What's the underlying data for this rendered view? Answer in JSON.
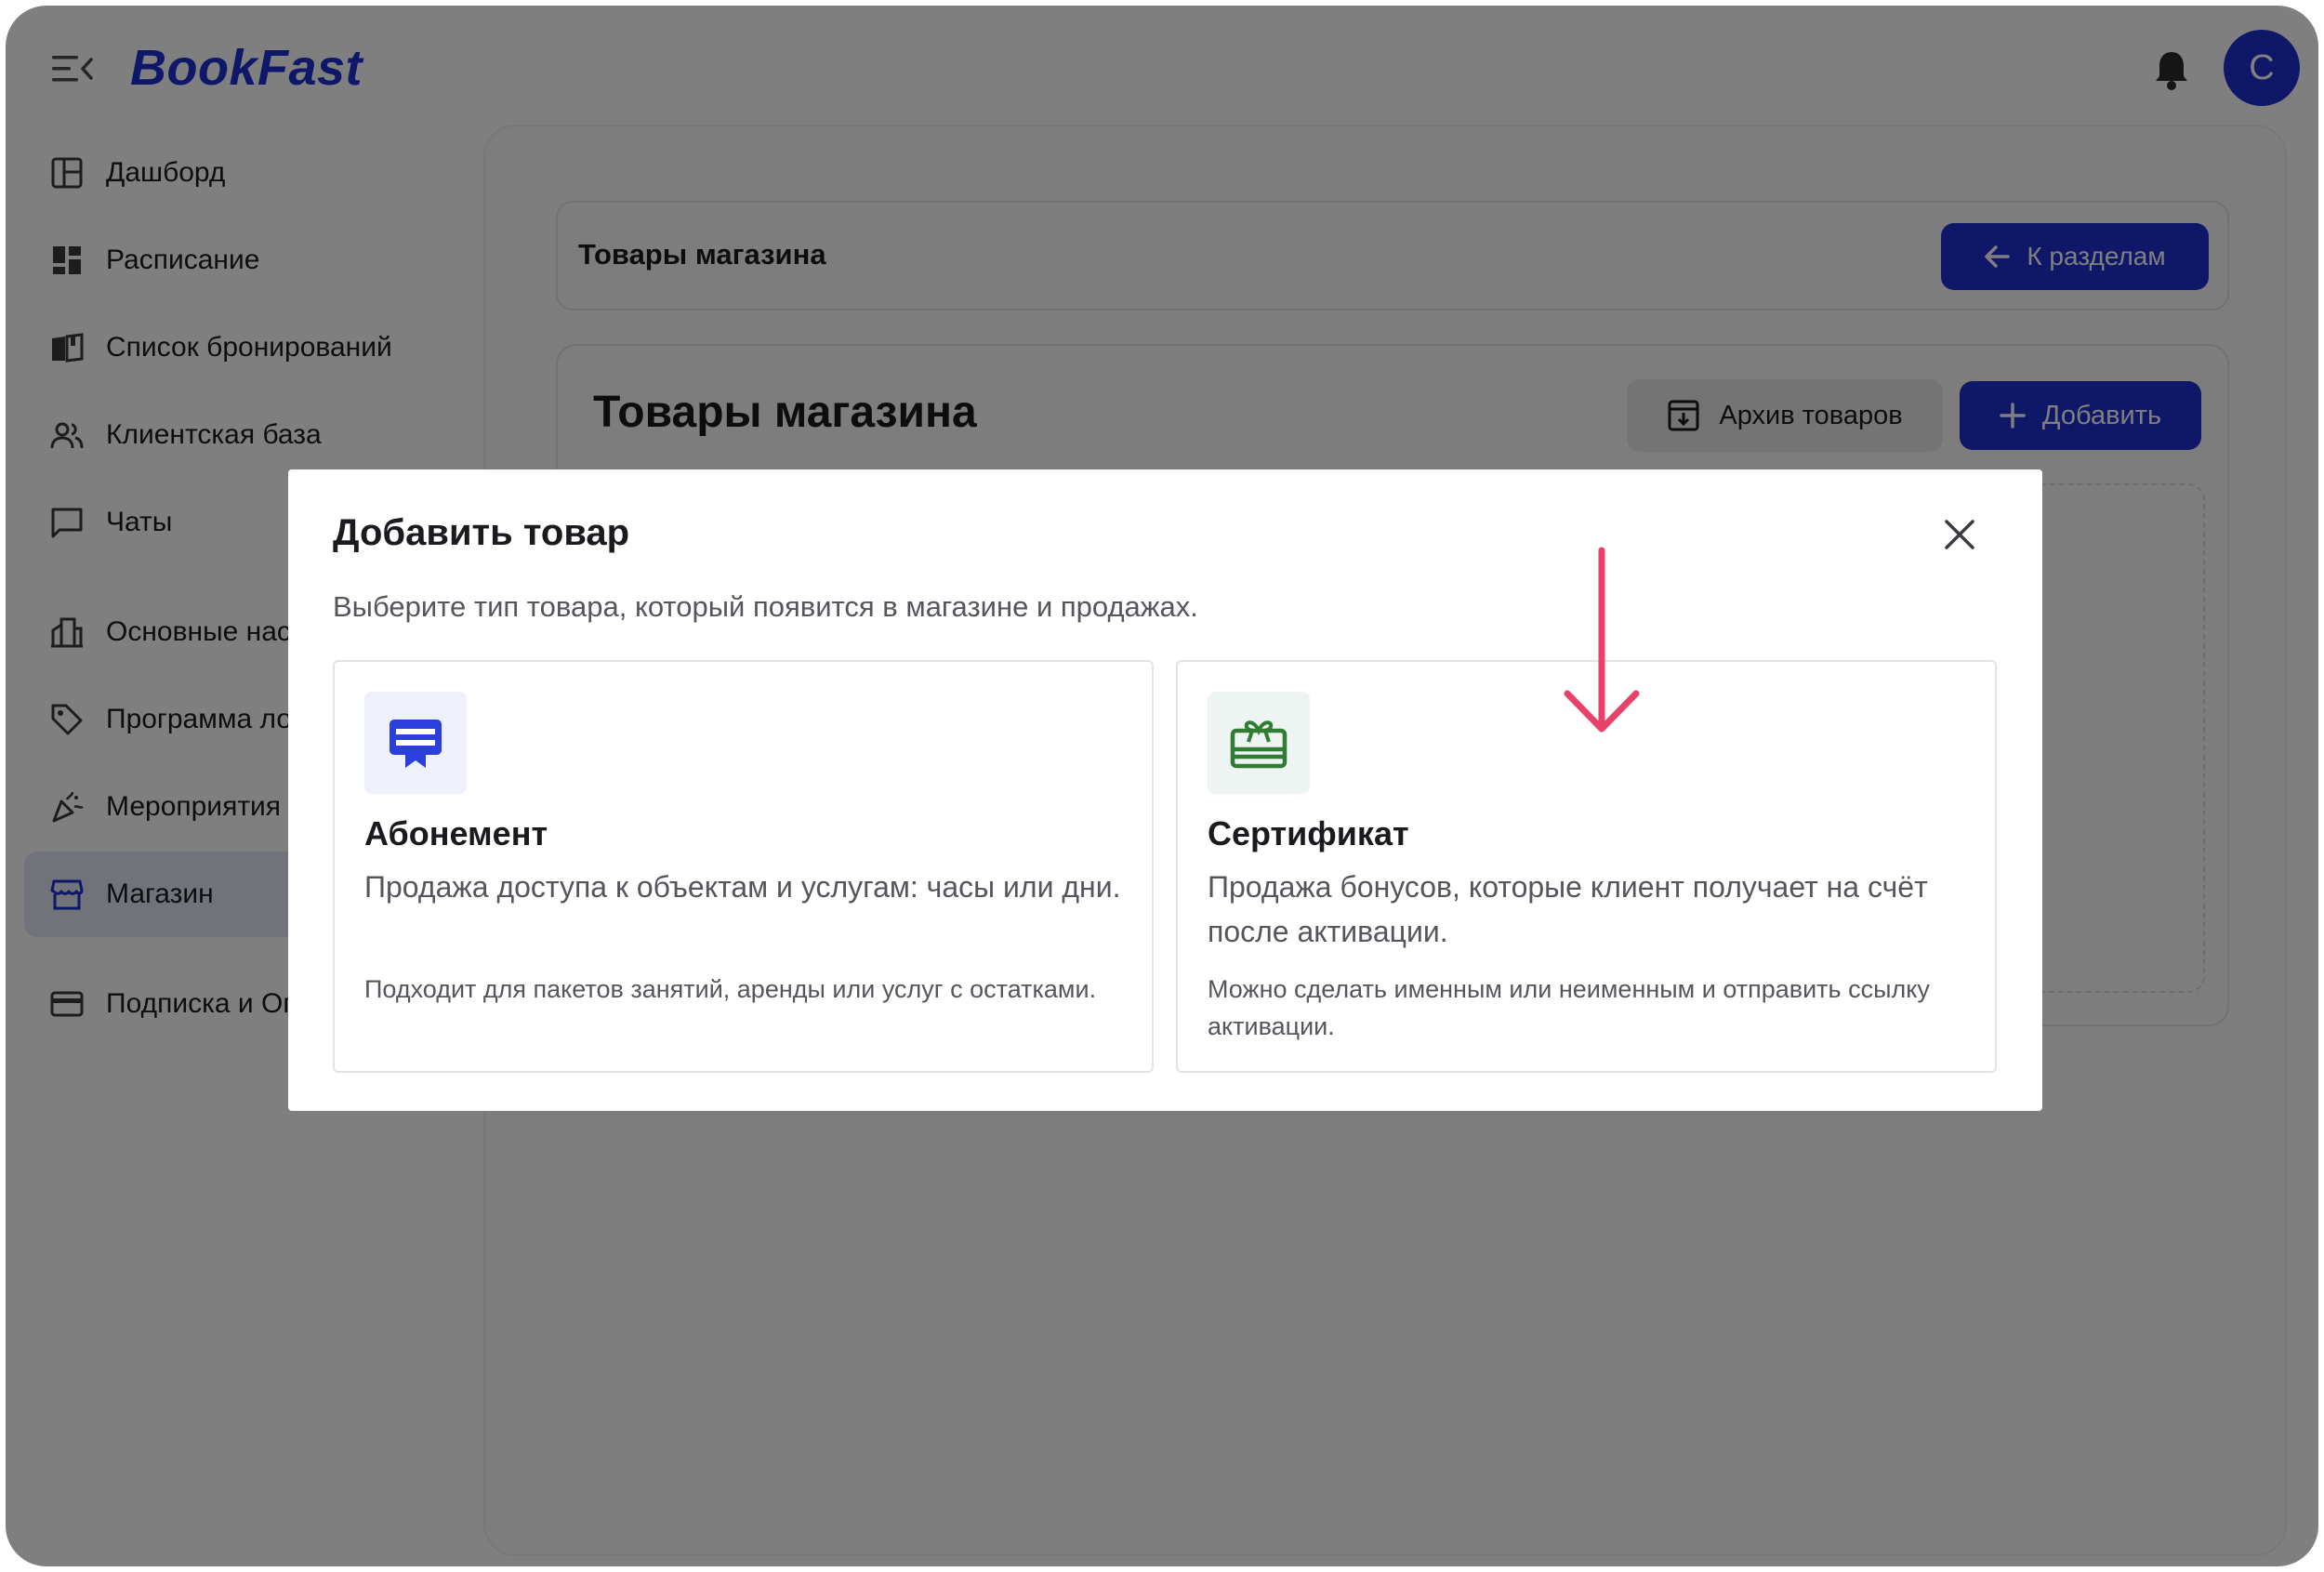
{
  "header": {
    "logo": "BookFast",
    "avatar_letter": "С"
  },
  "sidebar": {
    "items": [
      {
        "label": "Дашборд",
        "icon": "dashboard-icon"
      },
      {
        "label": "Расписание",
        "icon": "schedule-icon"
      },
      {
        "label": "Список бронирований",
        "icon": "book-icon"
      },
      {
        "label": "Клиентская база",
        "icon": "clients-icon"
      },
      {
        "label": "Чаты",
        "icon": "chat-icon"
      },
      {
        "label": "Основные настройки",
        "icon": "building-icon"
      },
      {
        "label": "Программа лояльности",
        "icon": "tag-icon"
      },
      {
        "label": "Мероприятия",
        "icon": "party-icon"
      },
      {
        "label": "Магазин",
        "icon": "store-icon",
        "active": true
      },
      {
        "label": "Подписка и Оплата",
        "icon": "card-icon"
      }
    ]
  },
  "topbar": {
    "title": "Товары магазина",
    "back_label": "К разделам"
  },
  "content": {
    "title": "Товары магазина",
    "archive_label": "Архив товаров",
    "add_label": "Добавить"
  },
  "modal": {
    "title": "Добавить товар",
    "subtitle": "Выберите тип товара, который появится в магазине и продажах.",
    "options": [
      {
        "title": "Абонемент",
        "description": "Продажа доступа к объектам и услугам: часы или дни.",
        "note": "Подходит для пакетов занятий, аренды или услуг с остатками.",
        "icon": "membership-icon"
      },
      {
        "title": "Сертификат",
        "description": "Продажа бонусов, которые клиент получает на счёт после активации.",
        "note": "Можно сделать именным или неименным и отправить ссылку активации.",
        "icon": "gift-card-icon"
      }
    ]
  },
  "colors": {
    "brand": "#1f2fd1",
    "overlay": "#00000080",
    "annotation": "#e8416a",
    "certificate_icon": "#2e7d32"
  }
}
